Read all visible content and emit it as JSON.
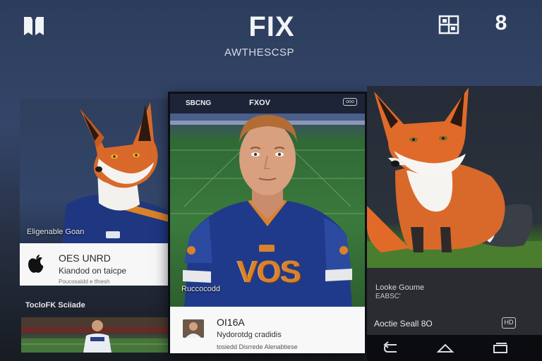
{
  "header": {
    "title": "FIX",
    "subtitle": "AWTHESCSP",
    "logo_icon": "book-logo-icon",
    "grid_icon": "grid-icon",
    "badge_count": "8"
  },
  "left_card": {
    "caption": "Eligenable Goan",
    "info_title": "OES UNRD",
    "info_subtitle": "Kiandod on taicpe",
    "info_tiny": "Poucosaldd e tfnesh",
    "section_title": "TocloFK Sciiade",
    "icon": "apple-icon"
  },
  "center_card": {
    "top_left": "SBCNG",
    "top_middle": "FXOV",
    "top_right": "ooo",
    "jersey_text": "VOS",
    "left_label": "Ruccocodd",
    "info_title": "OI16A",
    "info_subtitle": "Nydorotdg cradidis",
    "info_tiny": "tosiedd Disrrede Alenabtiese"
  },
  "right_card": {
    "info_line1": "Looke Goume",
    "info_line2": "EABSC'",
    "info_line3": "Aoctie Seall 8O",
    "hd_label": "HD",
    "nav": [
      "back-icon",
      "home-icon",
      "recents-icon"
    ]
  },
  "colors": {
    "background_top": "#2c3d5c",
    "jersey_blue": "#1f3a8a",
    "jersey_orange": "#d9822b",
    "fox_orange": "#d9692a",
    "nav_bar": "#0b0c0f"
  }
}
